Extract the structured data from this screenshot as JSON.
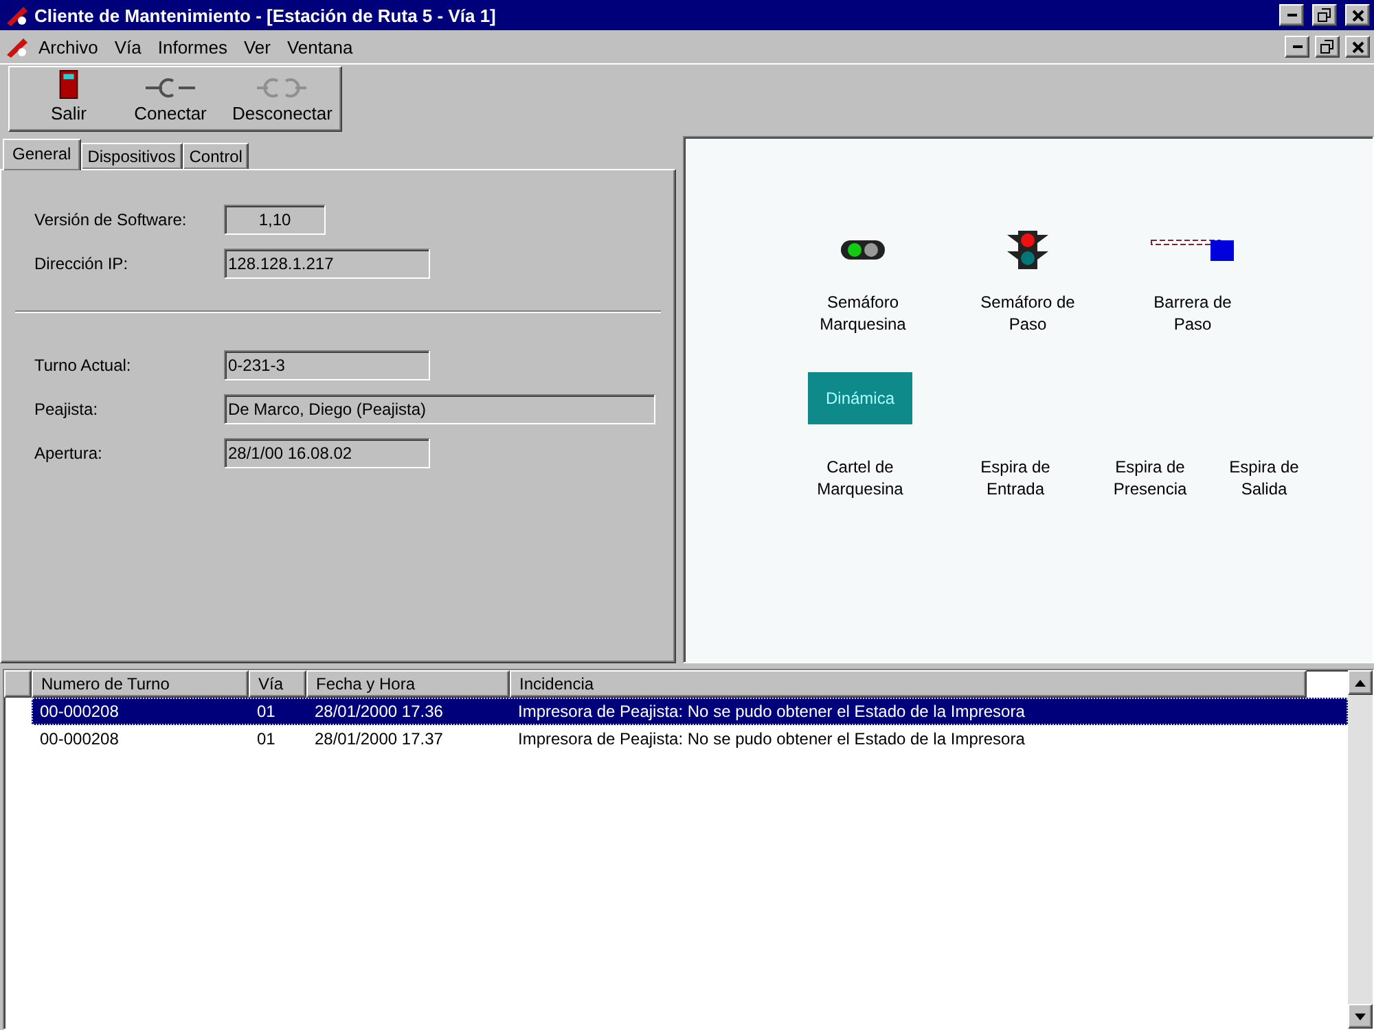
{
  "window": {
    "title": "Cliente de Mantenimiento - [Estación de Ruta 5 - Vía 1]"
  },
  "menu": [
    "Archivo",
    "Vía",
    "Informes",
    "Ver",
    "Ventana"
  ],
  "toolbar": [
    {
      "label": "Salir",
      "kind": "exit",
      "disabled": false
    },
    {
      "label": "Conectar",
      "kind": "connect",
      "disabled": false
    },
    {
      "label": "Desconectar",
      "kind": "disconnect",
      "disabled": true
    }
  ],
  "tabs": [
    {
      "label": "General",
      "selected": true
    },
    {
      "label": "Dispositivos",
      "selected": false
    },
    {
      "label": "Control",
      "selected": false
    }
  ],
  "general": {
    "group_1": [
      {
        "label": "Versión de Software:",
        "value": "1,10",
        "kind": "short"
      },
      {
        "label": "Dirección IP:",
        "value": "128.128.1.217",
        "kind": "medium"
      }
    ],
    "group_2": [
      {
        "label": "Turno Actual:",
        "value": "0-231-3",
        "kind": "medium"
      },
      {
        "label": "Peajista:",
        "value": "De Marco, Diego (Peajista)",
        "kind": "long"
      },
      {
        "label": "Apertura:",
        "value": "28/1/00 16.08.02",
        "kind": "medium"
      }
    ]
  },
  "devices": [
    [
      {
        "kind": "lamp",
        "name": "Semáforo Marquesina"
      },
      {
        "kind": "traffic-light",
        "name": "Semáforo de Paso"
      },
      {
        "kind": "barrier",
        "name": "Barrera de Paso"
      }
    ],
    [
      {
        "kind": "sign",
        "sign_text": "Dinámica",
        "name": "Cartel de Marquesina"
      },
      {
        "kind": "loop",
        "name": "Espira de Entrada"
      },
      {
        "kind": "loop",
        "name": "Espira de Presencia"
      },
      {
        "kind": "loop",
        "name": "Espira de Salida"
      }
    ]
  ],
  "table": {
    "columns": [
      "Numero de Turno",
      "Vía",
      "Fecha y Hora",
      "Incidencia"
    ],
    "rows": [
      {
        "cells": [
          "00-000208",
          "01",
          "28/01/2000 17.36",
          "Impresora de Peajista: No se pudo obtener el Estado de la Impresora"
        ],
        "selected": true
      },
      {
        "cells": [
          "00-000208",
          "01",
          "28/01/2000 17.37",
          "Impresora de Peajista: No se pudo obtener el Estado de la Impresora"
        ],
        "selected": false
      }
    ]
  }
}
